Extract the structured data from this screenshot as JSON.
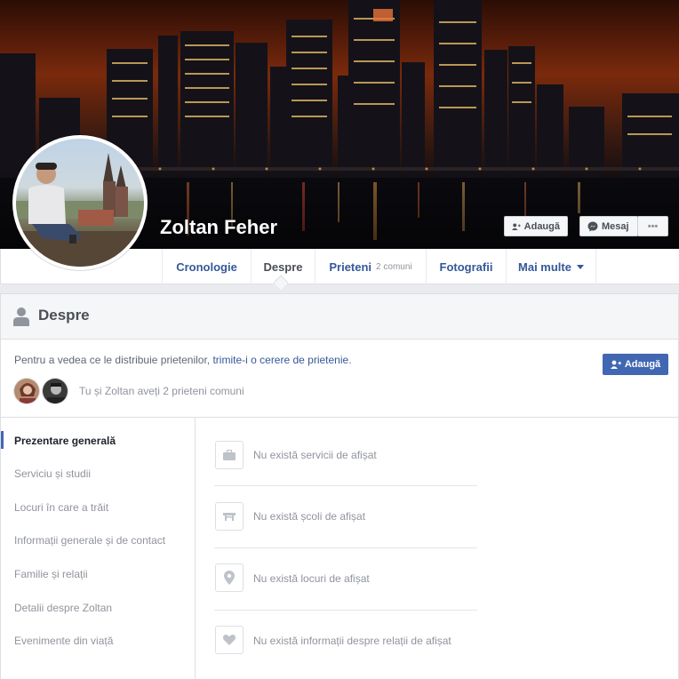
{
  "profile": {
    "name": "Zoltan Feher"
  },
  "cover_actions": {
    "add_label": "Adaugă",
    "message_label": "Mesaj",
    "more_label": "•••"
  },
  "nav": {
    "tabs": [
      {
        "label": "Cronologie"
      },
      {
        "label": "Despre"
      },
      {
        "label": "Prieteni",
        "sub": "2 comuni"
      },
      {
        "label": "Fotografii"
      },
      {
        "label": "Mai multe"
      }
    ]
  },
  "about": {
    "title": "Despre",
    "notice_text": "Pentru a vedea ce le distribuie prietenilor, ",
    "notice_link": "trimite-i o cerere de prietenie",
    "notice_end": ".",
    "add_button": "Adaugă",
    "mutual_text": "Tu și Zoltan aveți 2 prieteni comuni",
    "sections": [
      "Prezentare generală",
      "Serviciu și studii",
      "Locuri în care a trăit",
      "Informații generale și de contact",
      "Familie și relații",
      "Detalii despre Zoltan",
      "Evenimente din viață"
    ],
    "overview_rows": [
      {
        "icon": "briefcase-icon",
        "text": "Nu există servicii de afișat"
      },
      {
        "icon": "school-icon",
        "text": "Nu există școli de afișat"
      },
      {
        "icon": "location-pin-icon",
        "text": "Nu există locuri de afișat"
      },
      {
        "icon": "heart-icon",
        "text": "Nu există informații despre relații de afișat"
      }
    ]
  },
  "colors": {
    "link_blue": "#365899",
    "primary_button": "#4267b2",
    "page_bg": "#e9ebee"
  }
}
